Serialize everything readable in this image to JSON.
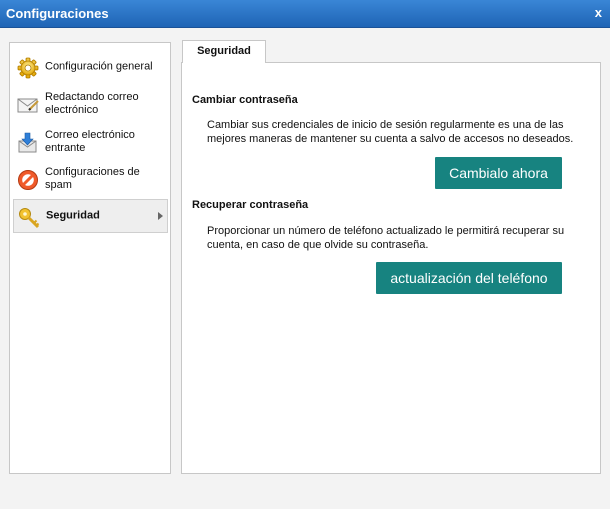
{
  "window": {
    "title": "Configuraciones",
    "close_label": "x"
  },
  "sidebar": {
    "items": [
      {
        "label": "Configuración general",
        "icon": "gear-icon"
      },
      {
        "label": "Redactando correo electrónico",
        "icon": "envelope-edit-icon"
      },
      {
        "label": "Correo electrónico entrante",
        "icon": "inbox-download-icon"
      },
      {
        "label": "Configuraciones de spam",
        "icon": "spam-block-icon"
      },
      {
        "label": "Seguridad",
        "icon": "key-icon",
        "active": true
      }
    ]
  },
  "tabs": [
    {
      "label": "Seguridad",
      "active": true
    }
  ],
  "security": {
    "change_password": {
      "title": "Cambiar contraseña",
      "text": "Cambiar sus credenciales de inicio de sesión regularmente es una de las mejores maneras de mantener su cuenta a salvo de accesos no deseados.",
      "button_label": "Cambialo ahora"
    },
    "recover_password": {
      "title": "Recuperar contraseña",
      "text": "Proporcionar un número de teléfono actualizado le permitirá recuperar su cuenta, en caso de que olvide su contraseña.",
      "button_label": "actualización del teléfono"
    }
  },
  "colors": {
    "titlebar": "#2a74c6",
    "button": "#178380"
  }
}
